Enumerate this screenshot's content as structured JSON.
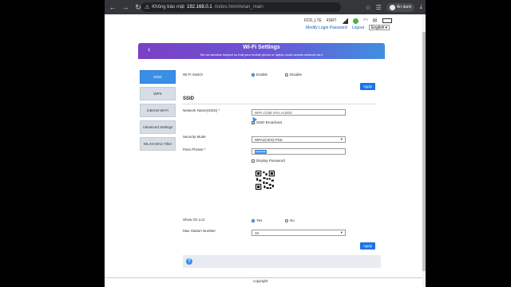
{
  "browser": {
    "warning": "Không bảo mật",
    "host": "192.168.0.1",
    "path": "/index.html#wlan_main",
    "profile_name": "Ẩn danh"
  },
  "status": {
    "network": "FDD_LTE",
    "mode": "4SRT"
  },
  "top_links": {
    "modify_login": "Modify Login Password",
    "logout": "Logout",
    "language": "English"
  },
  "header": {
    "title": "Wi-Fi Settings",
    "subtitle": "Set up wireless hotspot so that your mobile phone or laptop could access network via it"
  },
  "sidebar": {
    "items": [
      {
        "label": "SSID",
        "active": true
      },
      {
        "label": "WPS"
      },
      {
        "label": "Internet Wi-Fi"
      },
      {
        "label": "Advanced Settings"
      },
      {
        "label": "WLAN MAC Filter"
      }
    ]
  },
  "form": {
    "wifi_switch_label": "Wi-Fi Switch",
    "enable_label": "Enable",
    "disable_label": "Disable",
    "apply_label": "Apply",
    "section_ssid": "SSID",
    "ssid_label": "Network Name(SSID) *",
    "ssid_value": "WIFI.COM.VN-LAU003",
    "ssid_broadcast_label": "SSID Broadcast",
    "security_label": "Security Mode",
    "security_value": "WPA2(AES)-PSK",
    "passphrase_label": "Pass Phrase *",
    "passphrase_value": "••••••••",
    "display_password_label": "Display Password",
    "show_on_lcd_label": "Show On Lcd",
    "yes_label": "Yes",
    "no_label": "No",
    "max_station_label": "Max Station Number",
    "max_station_value": "10"
  },
  "footer": {
    "copyright": "copyright"
  },
  "colors": {
    "accent": "#1a73e8",
    "sidebar_active": "#3a8ee6",
    "header_start": "#7b3fc4",
    "header_end": "#3f8fe0"
  }
}
